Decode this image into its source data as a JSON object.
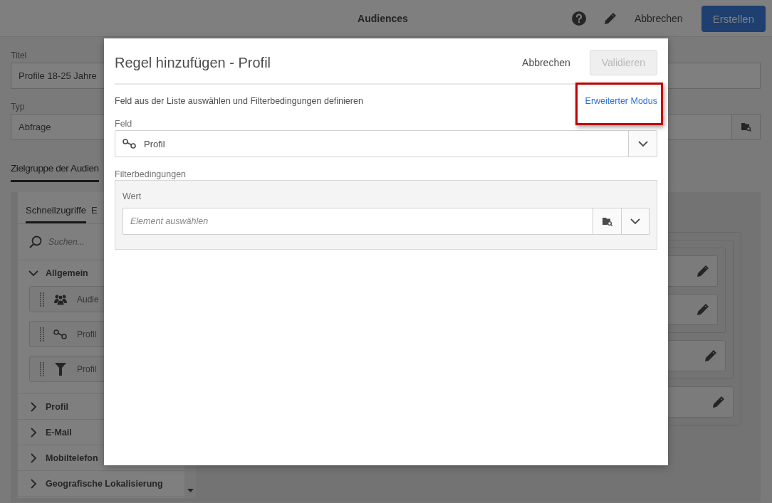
{
  "app_header": {
    "title": "Audiences",
    "cancel": "Abbrechen",
    "create": "Erstellen"
  },
  "form": {
    "fields": [
      {
        "label": "Titel",
        "value": "Profile 18-25 Jahre",
        "kind": "text"
      },
      {
        "label": "Typ",
        "value": "Abfrage",
        "kind": "picker"
      }
    ]
  },
  "section_tab": {
    "label": "Zielgruppe der Audien",
    "selected": true
  },
  "palette": {
    "tabs": [
      {
        "label": "Schnellzugriffe",
        "selected": true
      },
      {
        "label": "E",
        "selected": false
      }
    ],
    "search": {
      "placeholder": "Suchen..."
    },
    "groups": [
      {
        "label": "Allgemein",
        "expanded": true,
        "items": [
          {
            "label": "Audie",
            "kind": "audience"
          },
          {
            "label": "Profil",
            "kind": "link"
          },
          {
            "label": "Profil",
            "kind": "filter"
          }
        ]
      },
      {
        "label": "Profil",
        "expanded": false
      },
      {
        "label": "E-Mail",
        "expanded": false
      },
      {
        "label": "Mobiltelefon",
        "expanded": false
      },
      {
        "label": "Geografische Lokalisierung",
        "expanded": false
      }
    ]
  },
  "dialog": {
    "title": "Regel hinzufügen - Profil",
    "cancel": "Abbrechen",
    "validate": {
      "label": "Validieren",
      "disabled": true
    },
    "description": "Feld aus der Liste auswählen und Filterbedingungen definieren",
    "advanced_link": {
      "label": "Erweiterter Modus",
      "highlighted": true
    },
    "field": {
      "label": "Feld",
      "value": "Profil"
    },
    "filter": {
      "label": "Filterbedingungen",
      "value_label": "Wert",
      "placeholder": "Element auswählen"
    }
  }
}
